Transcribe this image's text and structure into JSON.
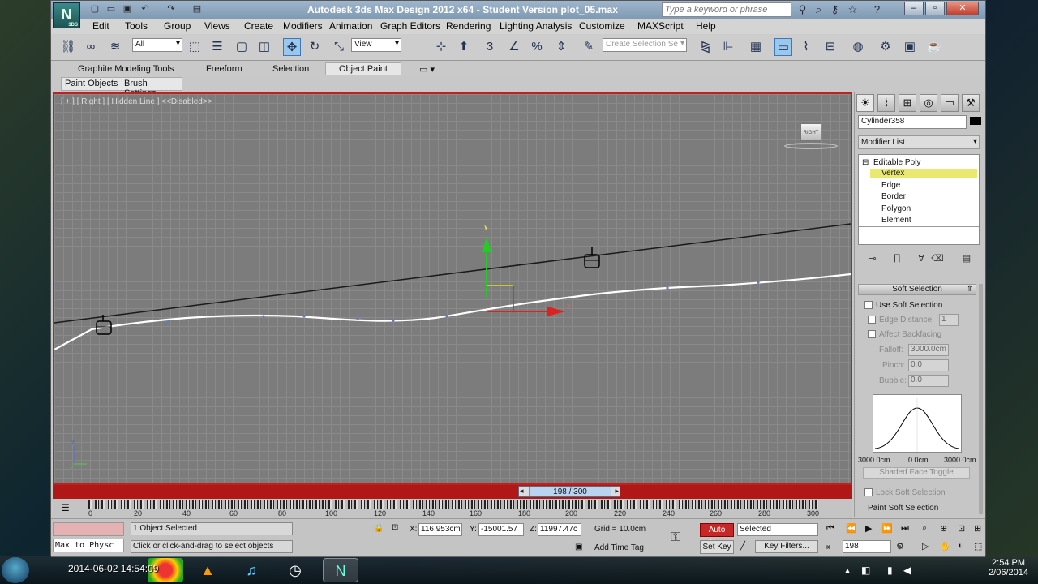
{
  "title_bar": {
    "title": "Autodesk 3ds Max Design 2012 x64 - Student Version plot_05.max",
    "search_placeholder": "Type a keyword or phrase",
    "logo_text": "N",
    "logo_sub": "3DS"
  },
  "menu": [
    "Edit",
    "Tools",
    "Group",
    "Views",
    "Create",
    "Modifiers",
    "Animation",
    "Graph Editors",
    "Rendering",
    "Lighting Analysis",
    "Customize",
    "MAXScript",
    "Help"
  ],
  "toolbar": {
    "filter_value": "All",
    "ref_coord_value": "View",
    "selection_set_placeholder": "Create Selection Se"
  },
  "ribbon": {
    "tabs": [
      "Graphite Modeling Tools",
      "Freeform",
      "Selection",
      "Object Paint"
    ],
    "active_tab": "Object Paint",
    "sub_items": [
      "Paint Objects",
      "Brush Settings"
    ]
  },
  "viewport": {
    "label": "[ + ] [ Right ] [ Hidden Line ] <<Disabled>>",
    "viewcube_label": "RIGHT",
    "gizmo_y": "y",
    "gizmo_x": "x",
    "axis_z": "z",
    "axis_y": "y"
  },
  "time_slider": {
    "current_frame": 198,
    "total_frames": 300,
    "display": "198 / 300"
  },
  "trackbar": {
    "ticks": [
      "0",
      "20",
      "40",
      "60",
      "80",
      "100",
      "120",
      "140",
      "160",
      "180",
      "200",
      "220",
      "240",
      "260",
      "280",
      "300"
    ]
  },
  "command_panel": {
    "object_name": "Cylinder358",
    "modifier_list_label": "Modifier List",
    "stack_root": "Editable Poly",
    "stack_items": [
      "Vertex",
      "Edge",
      "Border",
      "Polygon",
      "Element"
    ],
    "selected_sub": "Vertex",
    "rollout_title": "Soft Selection",
    "use_soft_selection": "Use Soft Selection",
    "edge_distance_label": "Edge Distance:",
    "edge_distance_value": "1",
    "affect_backfacing": "Affect Backfacing",
    "falloff_label": "Falloff:",
    "falloff_value": "3000.0cm",
    "pinch_label": "Pinch:",
    "pinch_value": "0.0",
    "bubble_label": "Bubble:",
    "bubble_value": "0.0",
    "curve_left": "3000.0cm",
    "curve_mid": "0.0cm",
    "curve_right": "3000.0cm",
    "shaded_face_toggle": "Shaded Face Toggle",
    "lock_soft_selection": "Lock Soft Selection",
    "paint_soft_selection": "Paint Soft Selection"
  },
  "status": {
    "maxscript_listener": "Max to Physc",
    "selection_status": "1 Object Selected",
    "prompt": "Click or click-and-drag to select objects",
    "x_label": "X:",
    "x_value": "116.953cm",
    "y_label": "Y:",
    "y_value": "-15001.57",
    "z_label": "Z:",
    "z_value": "11997.47c",
    "grid": "Grid = 10.0cm",
    "add_time_tag": "Add Time Tag",
    "auto_key": "Auto Key",
    "set_key": "Set Key",
    "key_mode": "Selected",
    "key_filters": "Key Filters...",
    "current_frame_field": "198"
  },
  "taskbar": {
    "overlay_timestamp": "2014-06-02 14:54:09",
    "clock_time": "2:54 PM",
    "clock_date": "2/06/2014"
  },
  "colors": {
    "viewport_border": "#c02020",
    "stack_selected": "#e9e971",
    "auto_key_active": "#c62828",
    "gizmo_x": "#d02020",
    "gizmo_y": "#22cc22"
  }
}
